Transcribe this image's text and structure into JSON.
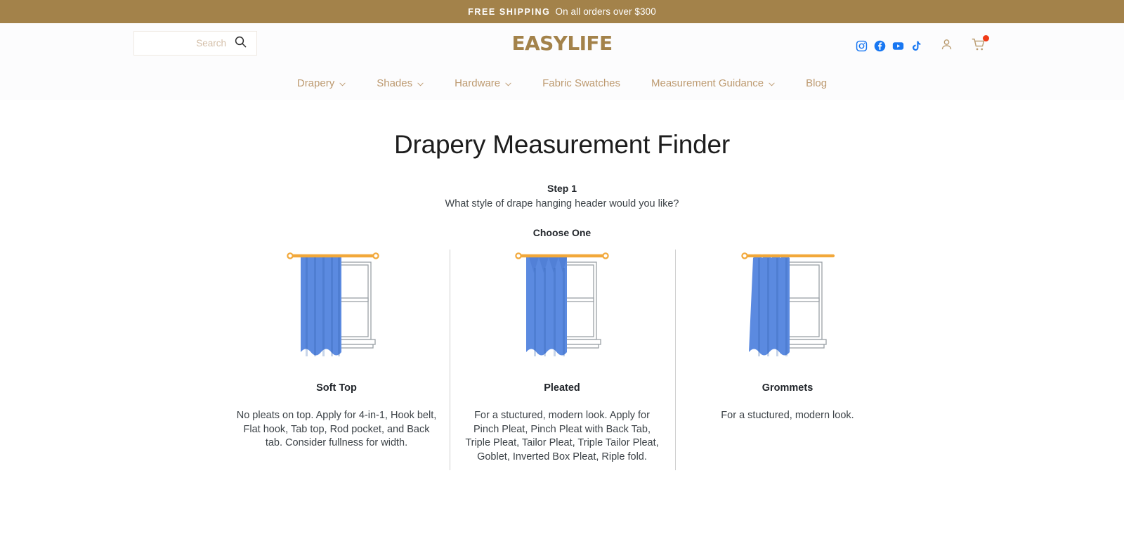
{
  "announcement": {
    "strong": "FREE SHIPPING",
    "rest": "On all orders over $300",
    "bg_color": "#a3824a"
  },
  "header": {
    "logo": "EASYLIFE",
    "logo_color": "#a3824a",
    "search": {
      "placeholder": "Search",
      "value": "",
      "icon": "search-icon"
    },
    "social": [
      {
        "name": "instagram-icon",
        "label": "Instagram",
        "color": "#1877f2"
      },
      {
        "name": "facebook-icon",
        "label": "Facebook",
        "color": "#1877f2"
      },
      {
        "name": "youtube-icon",
        "label": "YouTube",
        "color": "#1877f2"
      },
      {
        "name": "tiktok-icon",
        "label": "TikTok",
        "color": "#1877f2"
      }
    ],
    "account": {
      "name": "account-icon",
      "label": "Account",
      "color": "#b99a6e"
    },
    "cart": {
      "name": "cart-icon",
      "label": "Cart",
      "color": "#b99a6e",
      "badge_color": "#f03a17"
    }
  },
  "nav": {
    "items": [
      {
        "label": "Drapery",
        "has_dropdown": true
      },
      {
        "label": "Shades",
        "has_dropdown": true
      },
      {
        "label": "Hardware",
        "has_dropdown": true
      },
      {
        "label": "Fabric Swatches",
        "has_dropdown": false
      },
      {
        "label": "Measurement Guidance",
        "has_dropdown": true
      },
      {
        "label": "Blog",
        "has_dropdown": false
      }
    ],
    "link_color": "#bd9a70"
  },
  "main": {
    "title": "Drapery Measurement Finder",
    "step_label": "Step 1",
    "step_question": "What style of drape hanging header would you like?",
    "choose_label": "Choose One",
    "options": [
      {
        "title": "Soft Top",
        "description": "No pleats on top. Apply for 4-in-1, Hook belt, Flat hook, Tab top, Rod pocket, and Back tab. Consider fullness for width.",
        "art": "soft-top-curtain-illustration"
      },
      {
        "title": "Pleated",
        "description": "For a stuctured, modern look. Apply for Pinch Pleat, Pinch Pleat with Back Tab, Triple Pleat, Tailor Pleat, Triple Tailor Pleat, Goblet, Inverted Box Pleat, Riple fold.",
        "art": "pleated-curtain-illustration"
      },
      {
        "title": "Grommets",
        "description": "For a stuctured, modern look.",
        "art": "grommets-curtain-illustration"
      }
    ],
    "illustration_colors": {
      "rod": "#f2a83a",
      "curtain": "#5b8ae0",
      "curtain_dark": "#4f7fd6",
      "window": "#9aa0a6"
    }
  }
}
